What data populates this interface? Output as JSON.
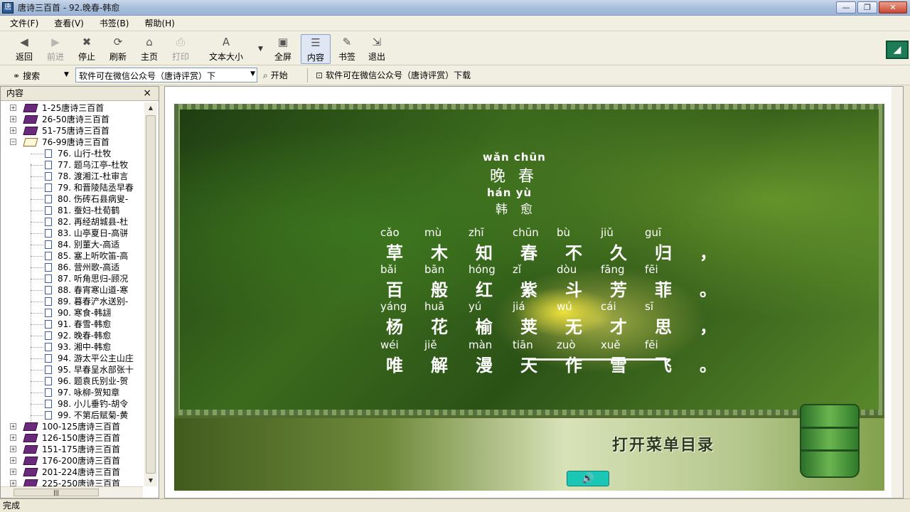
{
  "window": {
    "title": "唐诗三百首 - 92.晚春-韩愈",
    "minimize": "—",
    "maximize": "❐",
    "close": "✕"
  },
  "menu": {
    "items": [
      "文件(F)",
      "查看(V)",
      "书签(B)",
      "帮助(H)"
    ]
  },
  "toolbar": {
    "back": "返回",
    "forward": "前进",
    "stop": "停止",
    "refresh": "刷新",
    "home": "主页",
    "print": "打印",
    "text_size": "文本大小",
    "fullscreen": "全屏",
    "content": "内容",
    "bookmark": "书签",
    "exit": "退出"
  },
  "searchbar": {
    "search_label": "搜索",
    "combo_value": "软件可在微信公众号（唐诗评赏）下",
    "go_label": "开始",
    "info_text": "软件可在微信公众号（唐诗评赏）下载"
  },
  "left_pane": {
    "title": "内容",
    "close": "×",
    "groups_top": [
      "1-25唐诗三百首",
      "26-50唐诗三百首",
      "51-75唐诗三百首",
      "76-99唐诗三百首"
    ],
    "children": [
      "76. 山行-杜牧",
      "77. 题乌江亭-杜牧",
      "78. 渡湘江-杜审言",
      "79. 和晋陵陆丞早春",
      "80. 伤砖石县病叟-",
      "81. 蚕妇-杜荀鹤",
      "82. 再经胡城县-杜",
      "83. 山亭夏日-高骈",
      "84. 别董大-高适",
      "85. 塞上听吹笛-高",
      "86. 营州歌-高适",
      "87. 听角思归-顾况",
      "88. 春宵寒山道-寒",
      "89. 暮春浐水送别-",
      "90. 寒食-韩翃",
      "91. 春雪-韩愈",
      "92. 晚春-韩愈",
      "93. 湘中-韩愈",
      "94. 游太平公主山庄",
      "95. 早春呈水部张十",
      "96. 题袁氏别业-贺",
      "97. 咏柳-贺知章",
      "98. 小儿垂钓-胡令",
      "99. 不第后赋菊-黄"
    ],
    "groups_bottom": [
      "100-125唐诗三百首",
      "126-150唐诗三百首",
      "151-175唐诗三百首",
      "176-200唐诗三百首",
      "201-224唐诗三百首",
      "225-250唐诗三百首"
    ]
  },
  "poem": {
    "title_pinyin": "wǎn chūn",
    "title": "晚春",
    "author_pinyin": "hán yù",
    "author": "韩愈",
    "lines": [
      {
        "pinyin": [
          "cǎo",
          "mù",
          "zhī",
          "chūn",
          "bù",
          "jiǔ",
          "guī"
        ],
        "hanzi": [
          "草",
          "木",
          "知",
          "春",
          "不",
          "久",
          "归",
          "，"
        ]
      },
      {
        "pinyin": [
          "bǎi",
          "bān",
          "hóng",
          "zǐ",
          "dòu",
          "fāng",
          "fēi"
        ],
        "hanzi": [
          "百",
          "般",
          "红",
          "紫",
          "斗",
          "芳",
          "菲",
          "。"
        ]
      },
      {
        "pinyin": [
          "yáng",
          "huā",
          "yú",
          "jiá",
          "wú",
          "cái",
          "sī"
        ],
        "hanzi": [
          "杨",
          "花",
          "榆",
          "荚",
          "无",
          "才",
          "思",
          "，"
        ]
      },
      {
        "pinyin": [
          "wéi",
          "jiě",
          "màn",
          "tiān",
          "zuò",
          "xuě",
          "fēi"
        ],
        "hanzi": [
          "唯",
          "解",
          "漫",
          "天",
          "作",
          "雪",
          "飞",
          "。"
        ]
      }
    ]
  },
  "bottom": {
    "menu_button": "打开菜单目录",
    "sound_button": "🔊"
  },
  "status": {
    "text": "完成"
  }
}
